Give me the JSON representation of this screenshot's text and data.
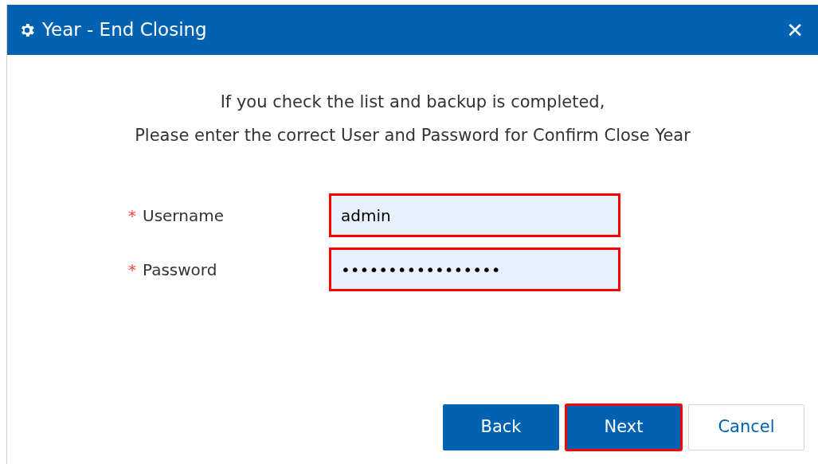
{
  "window": {
    "title": "Year - End Closing",
    "close": "✕"
  },
  "message": [
    "If you check the list and backup is completed,",
    "Please enter the correct User and Password for Confirm Close Year"
  ],
  "fields": [
    {
      "label": "Username",
      "required": "*",
      "value": "admin",
      "highlighted": true
    },
    {
      "label": "Password",
      "required": "*",
      "value": "•••••••••••••••••",
      "highlighted": true
    }
  ],
  "buttons": [
    {
      "label": "Back",
      "kind": "primary",
      "highlighted": false
    },
    {
      "label": "Next",
      "kind": "primary",
      "highlighted": true
    },
    {
      "label": "Cancel",
      "kind": "secondary",
      "highlighted": false
    }
  ]
}
